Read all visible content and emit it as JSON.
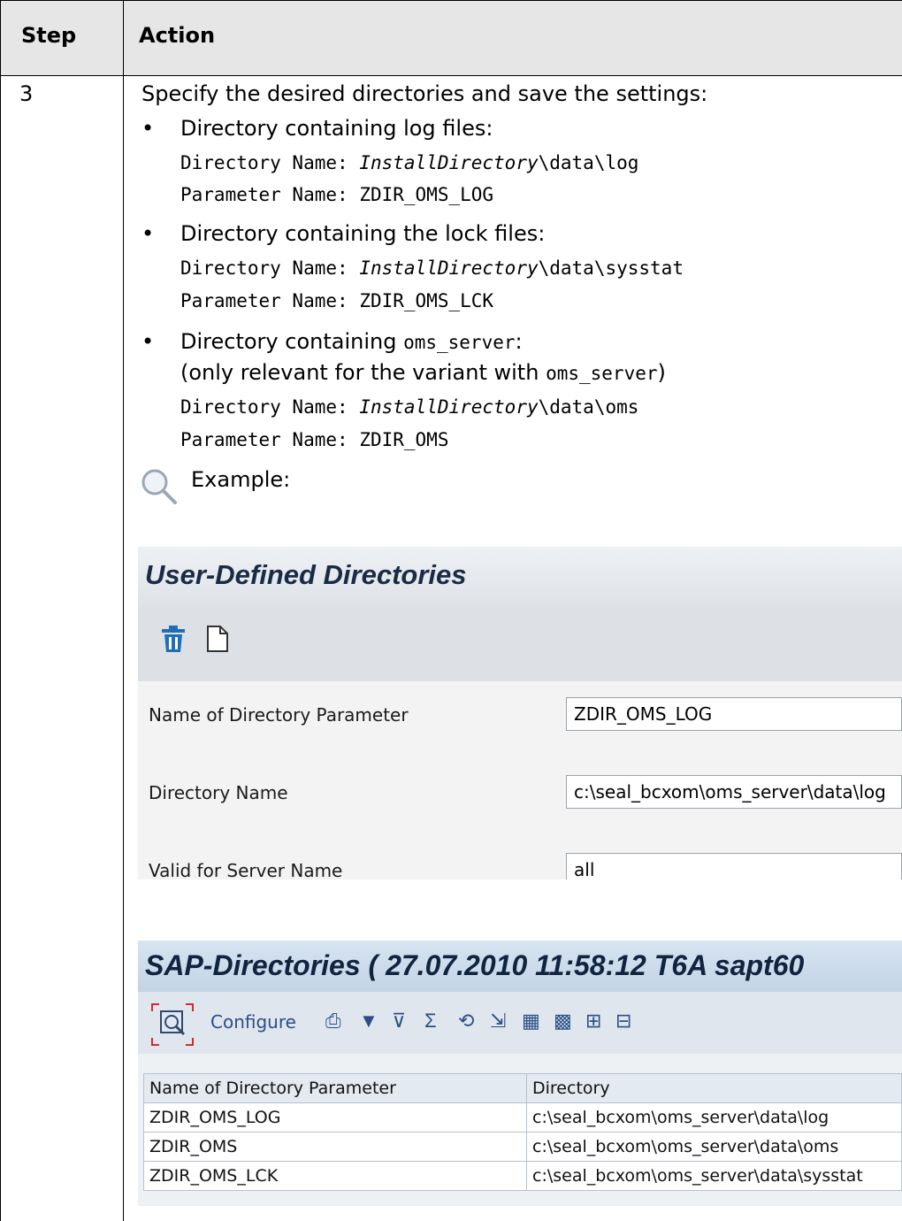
{
  "table": {
    "header": {
      "step": "Step",
      "action": "Action"
    },
    "row": {
      "step": "3",
      "intro": "Specify the desired directories and save the settings:",
      "bullets": [
        {
          "title": "Directory containing log files:",
          "dir_label": "Directory Name:",
          "dir_var": "InstallDirectory",
          "dir_path": "\\data\\log",
          "param_label": "Parameter Name:",
          "param_value": "ZDIR_OMS_LOG"
        },
        {
          "title": "Directory containing the lock files:",
          "dir_label": "Directory Name:",
          "dir_var": "InstallDirectory",
          "dir_path": "\\data\\sysstat",
          "param_label": "Parameter Name:",
          "param_value": "ZDIR_OMS_LCK"
        },
        {
          "title_pre": "Directory containing ",
          "title_code": "oms_server",
          "title_post": ":",
          "note_pre": "(only relevant for the variant with ",
          "note_code": "oms_server",
          "note_post": ")",
          "dir_label": "Directory Name:",
          "dir_var": "InstallDirectory",
          "dir_path": "\\data\\oms",
          "param_label": "Parameter Name:",
          "param_value": "ZDIR_OMS"
        }
      ],
      "example_label": "Example:"
    }
  },
  "user_defined": {
    "title": "User-Defined Directories",
    "fields": [
      {
        "label": "Name of Directory Parameter",
        "value": "ZDIR_OMS_LOG"
      },
      {
        "label": "Directory Name",
        "value": "c:\\seal_bcxom\\oms_server\\data\\log"
      },
      {
        "label": "Valid for Server Name",
        "value": "all"
      }
    ]
  },
  "sap_directories": {
    "title": "SAP-Directories ( 27.07.2010 11:58:12 T6A sapt60",
    "configure_label": "Configure",
    "columns": [
      "Name of Directory Parameter",
      "Directory"
    ],
    "rows": [
      [
        "ZDIR_OMS_LOG",
        "c:\\seal_bcxom\\oms_server\\data\\log"
      ],
      [
        "ZDIR_OMS",
        "c:\\seal_bcxom\\oms_server\\data\\oms"
      ],
      [
        "ZDIR_OMS_LCK",
        "c:\\seal_bcxom\\oms_server\\data\\sysstat"
      ]
    ]
  },
  "colors": {
    "header_bg": "#e6e6e6",
    "sap_title": "#10243f",
    "delete_icon": "#1f6fb8"
  }
}
